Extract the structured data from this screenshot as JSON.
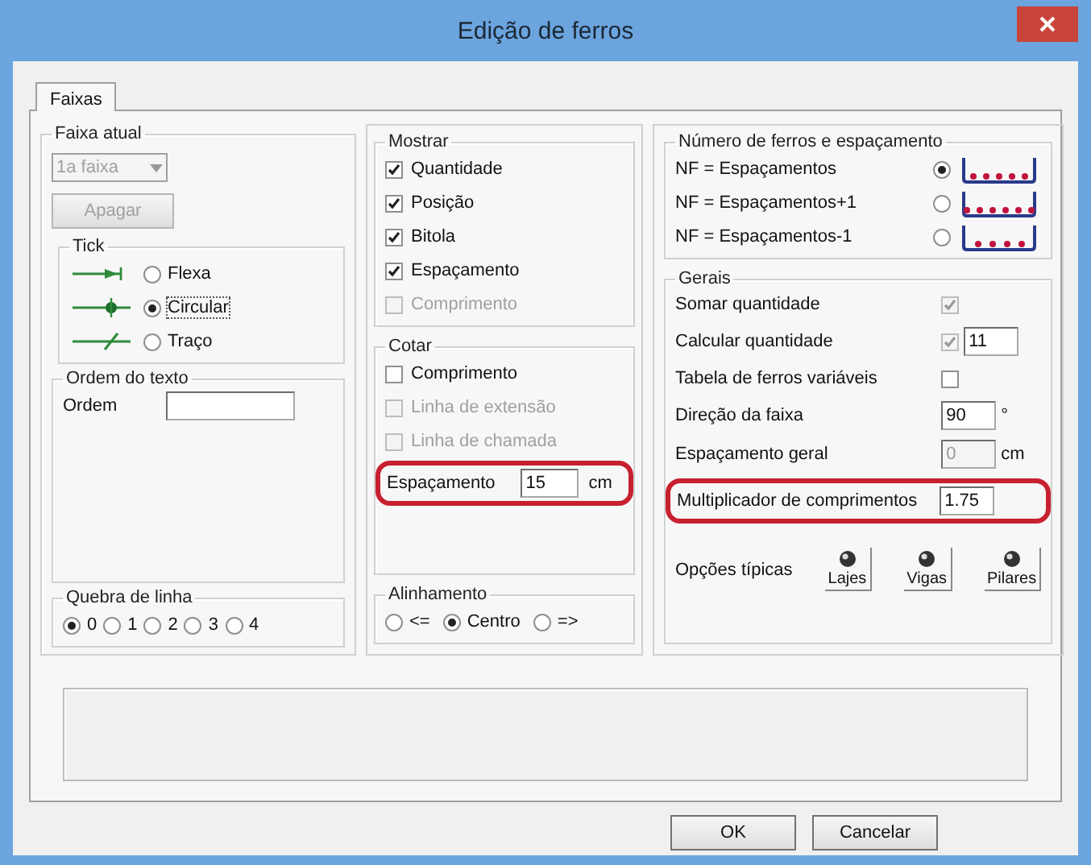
{
  "window": {
    "title": "Edição de ferros"
  },
  "tabs": [
    {
      "label": "Faixas",
      "selected": true
    }
  ],
  "faixa_atual": {
    "title": "Faixa atual",
    "combo": {
      "value": "1a faixa",
      "disabled": true
    },
    "button": {
      "label": "Apagar",
      "disabled": true
    }
  },
  "tick": {
    "title": "Tick",
    "options": [
      {
        "label": "Flexa",
        "kind": "arrow",
        "selected": false
      },
      {
        "label": "Circular",
        "kind": "dot",
        "selected": true
      },
      {
        "label": "Traço",
        "kind": "slash",
        "selected": false
      }
    ]
  },
  "ordem_texto": {
    "title": "Ordem do texto",
    "label": "Ordem"
  },
  "quebra_linha": {
    "title": "Quebra de linha",
    "options": [
      {
        "label": "0",
        "selected": true
      },
      {
        "label": "1",
        "selected": false
      },
      {
        "label": "2",
        "selected": false
      },
      {
        "label": "3",
        "selected": false
      },
      {
        "label": "4",
        "selected": false
      }
    ]
  },
  "mostrar": {
    "title": "Mostrar",
    "items": [
      {
        "label": "Quantidade",
        "checked": true,
        "disabled": false
      },
      {
        "label": "Posição",
        "checked": true,
        "disabled": false
      },
      {
        "label": "Bitola",
        "checked": true,
        "disabled": false
      },
      {
        "label": "Espaçamento",
        "checked": true,
        "disabled": false
      },
      {
        "label": "Comprimento",
        "checked": false,
        "disabled": true
      }
    ]
  },
  "cotar": {
    "title": "Cotar",
    "items": [
      {
        "label": "Comprimento",
        "checked": false,
        "disabled": false
      },
      {
        "label": "Linha de extensão",
        "checked": false,
        "disabled": true
      },
      {
        "label": "Linha de chamada",
        "checked": false,
        "disabled": true
      }
    ],
    "spacing": {
      "label": "Espaçamento",
      "value": "15",
      "unit": "cm",
      "highlighted": true
    }
  },
  "alinhamento": {
    "title": "Alinhamento",
    "options": [
      {
        "label": "<=",
        "selected": false
      },
      {
        "label": "Centro",
        "selected": true
      },
      {
        "label": "=>",
        "selected": false
      }
    ]
  },
  "numero_ferros": {
    "title": "Número de ferros e espaçamento",
    "options": [
      {
        "label": "NF = Espaçamentos",
        "kind": "equal",
        "selected": true
      },
      {
        "label": "NF = Espaçamentos+1",
        "kind": "plus",
        "selected": false
      },
      {
        "label": "NF = Espaçamentos-1",
        "kind": "minus",
        "selected": false
      }
    ]
  },
  "gerais": {
    "title": "Gerais",
    "rows": [
      {
        "kind": "checkbox",
        "label": "Somar quantidade",
        "checked": true,
        "disabled": true
      },
      {
        "kind": "checkbox-field",
        "label": "Calcular quantidade",
        "checked": true,
        "disabled": true,
        "value": "11"
      },
      {
        "kind": "checkbox",
        "label": "Tabela de ferros variáveis",
        "checked": false,
        "disabled": false
      },
      {
        "kind": "field",
        "label": "Direção da faixa",
        "value": "90",
        "unit": "°",
        "disabled": false
      },
      {
        "kind": "field",
        "label": "Espaçamento geral",
        "value": "0",
        "unit": "cm",
        "disabled": true
      },
      {
        "kind": "field",
        "label": "Multiplicador de comprimentos",
        "value": "1.75",
        "disabled": false,
        "highlighted": true
      }
    ],
    "typical": {
      "label": "Opções típicas",
      "buttons": [
        "Lajes",
        "Vigas",
        "Pilares"
      ]
    }
  },
  "buttons": [
    "OK",
    "Cancelar"
  ]
}
